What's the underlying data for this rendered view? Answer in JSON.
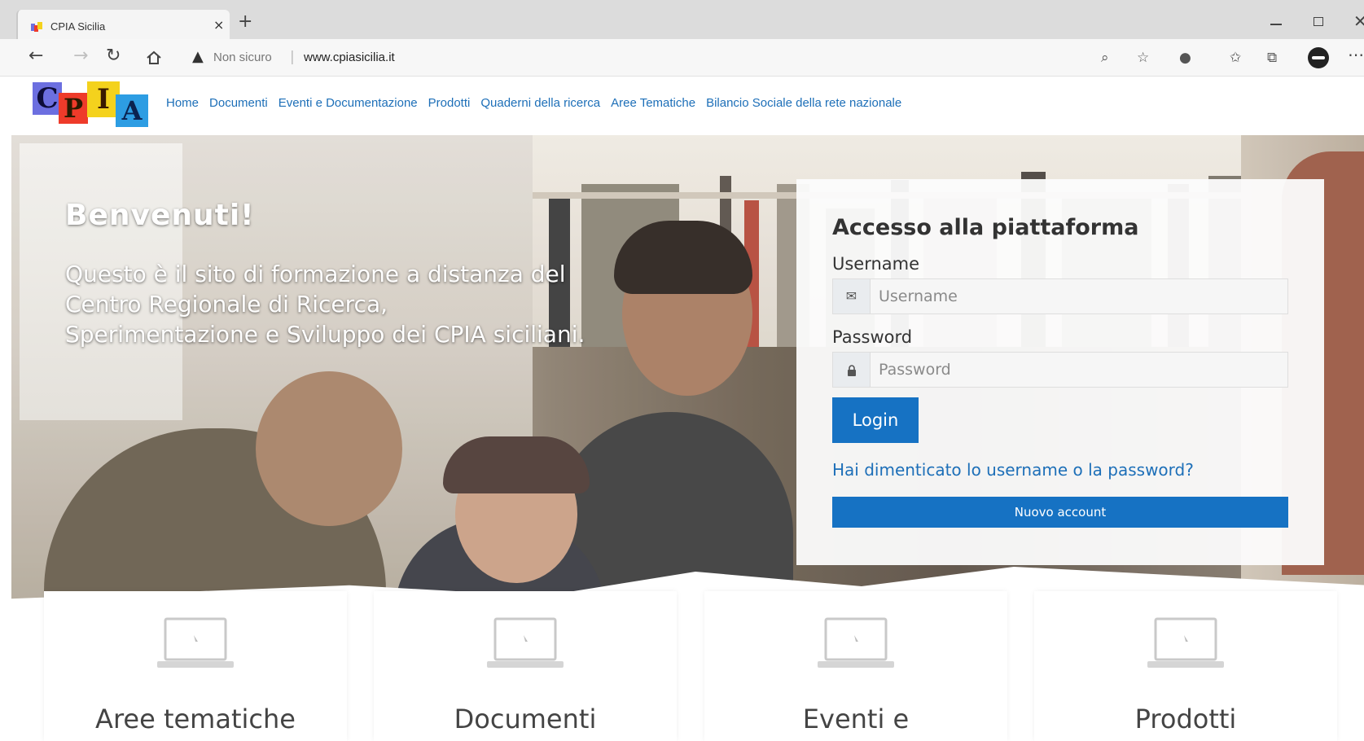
{
  "browser": {
    "tab_title": "CPIA Sicilia",
    "tab_close": "×",
    "new_tab": "+",
    "security_label": "Non sicuro",
    "url": "www.cpiasicilia.it",
    "url_separator": "|"
  },
  "header": {
    "logo": {
      "c": "C",
      "p": "P",
      "i": "I",
      "a": "A"
    },
    "nav": [
      {
        "label": "Home"
      },
      {
        "label": "Documenti"
      },
      {
        "label": "Eventi e Documentazione"
      },
      {
        "label": "Prodotti"
      },
      {
        "label": "Quaderni della ricerca"
      },
      {
        "label": "Aree Tematiche"
      },
      {
        "label": "Bilancio Sociale della rete nazionale"
      }
    ]
  },
  "hero": {
    "title": "Benvenuti!",
    "text": "Questo è il sito di formazione a distanza del Centro Regionale di Ricerca, Sperimentazione e Sviluppo dei CPIA siciliani."
  },
  "login": {
    "title": "Accesso alla piattaforma",
    "username_label": "Username",
    "username_placeholder": "Username",
    "password_label": "Password",
    "password_placeholder": "Password",
    "login_button": "Login",
    "forgot_link": "Hai dimenticato lo username o la password?",
    "new_account_button": "Nuovo account"
  },
  "cards": [
    {
      "title": "Aree tematiche"
    },
    {
      "title": "Documenti"
    },
    {
      "title": "Eventi e"
    },
    {
      "title": "Prodotti"
    }
  ],
  "colors": {
    "primary_blue": "#1672c3",
    "link_blue": "#1d6fb8",
    "logo_c": "#6c6fe0",
    "logo_p": "#ee3b2a",
    "logo_i": "#f4d21d",
    "logo_a": "#2d9de3"
  },
  "icons": {
    "username_addon": "envelope-icon",
    "password_addon": "lock-icon",
    "card_icon": "laptop-icon"
  }
}
